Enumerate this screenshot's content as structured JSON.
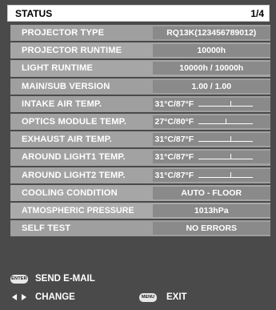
{
  "header": {
    "title": "STATUS",
    "page": "1/4"
  },
  "rows": [
    {
      "label": "PROJECTOR TYPE",
      "value": "RQ13K(123456789012)"
    },
    {
      "label": "PROJECTOR RUNTIME",
      "value": "10000h"
    },
    {
      "label": "LIGHT RUNTIME",
      "value": "10000h / 10000h"
    },
    {
      "label": "MAIN/SUB VERSION",
      "value": "1.00 / 1.00"
    },
    {
      "label": "INTAKE AIR TEMP.",
      "value": "31°C/87°F"
    },
    {
      "label": "OPTICS MODULE TEMP.",
      "value": "27°C/80°F"
    },
    {
      "label": "EXHAUST AIR TEMP.",
      "value": "31°C/87°F"
    },
    {
      "label": "AROUND LIGHT1 TEMP.",
      "value": "31°C/87°F"
    },
    {
      "label": "AROUND LIGHT2 TEMP.",
      "value": "31°C/87°F"
    },
    {
      "label": "COOLING CONDITION",
      "value": "AUTO - FLOOR"
    },
    {
      "label": "ATMOSPHERIC PRESSURE",
      "value": "1013hPa"
    },
    {
      "label": "SELF TEST",
      "value": "NO ERRORS"
    }
  ],
  "footer": {
    "enter_key": "ENTER",
    "send_email": "SEND E-MAIL",
    "change": "CHANGE",
    "menu_key": "MENU",
    "exit": "EXIT"
  },
  "colors": {
    "background": "#4a4a4a",
    "row": "#a2a2a2",
    "value_box": "#8a8a8a",
    "text": "#ffffff"
  },
  "icons": {
    "change": "left-right-arrows-icon"
  }
}
